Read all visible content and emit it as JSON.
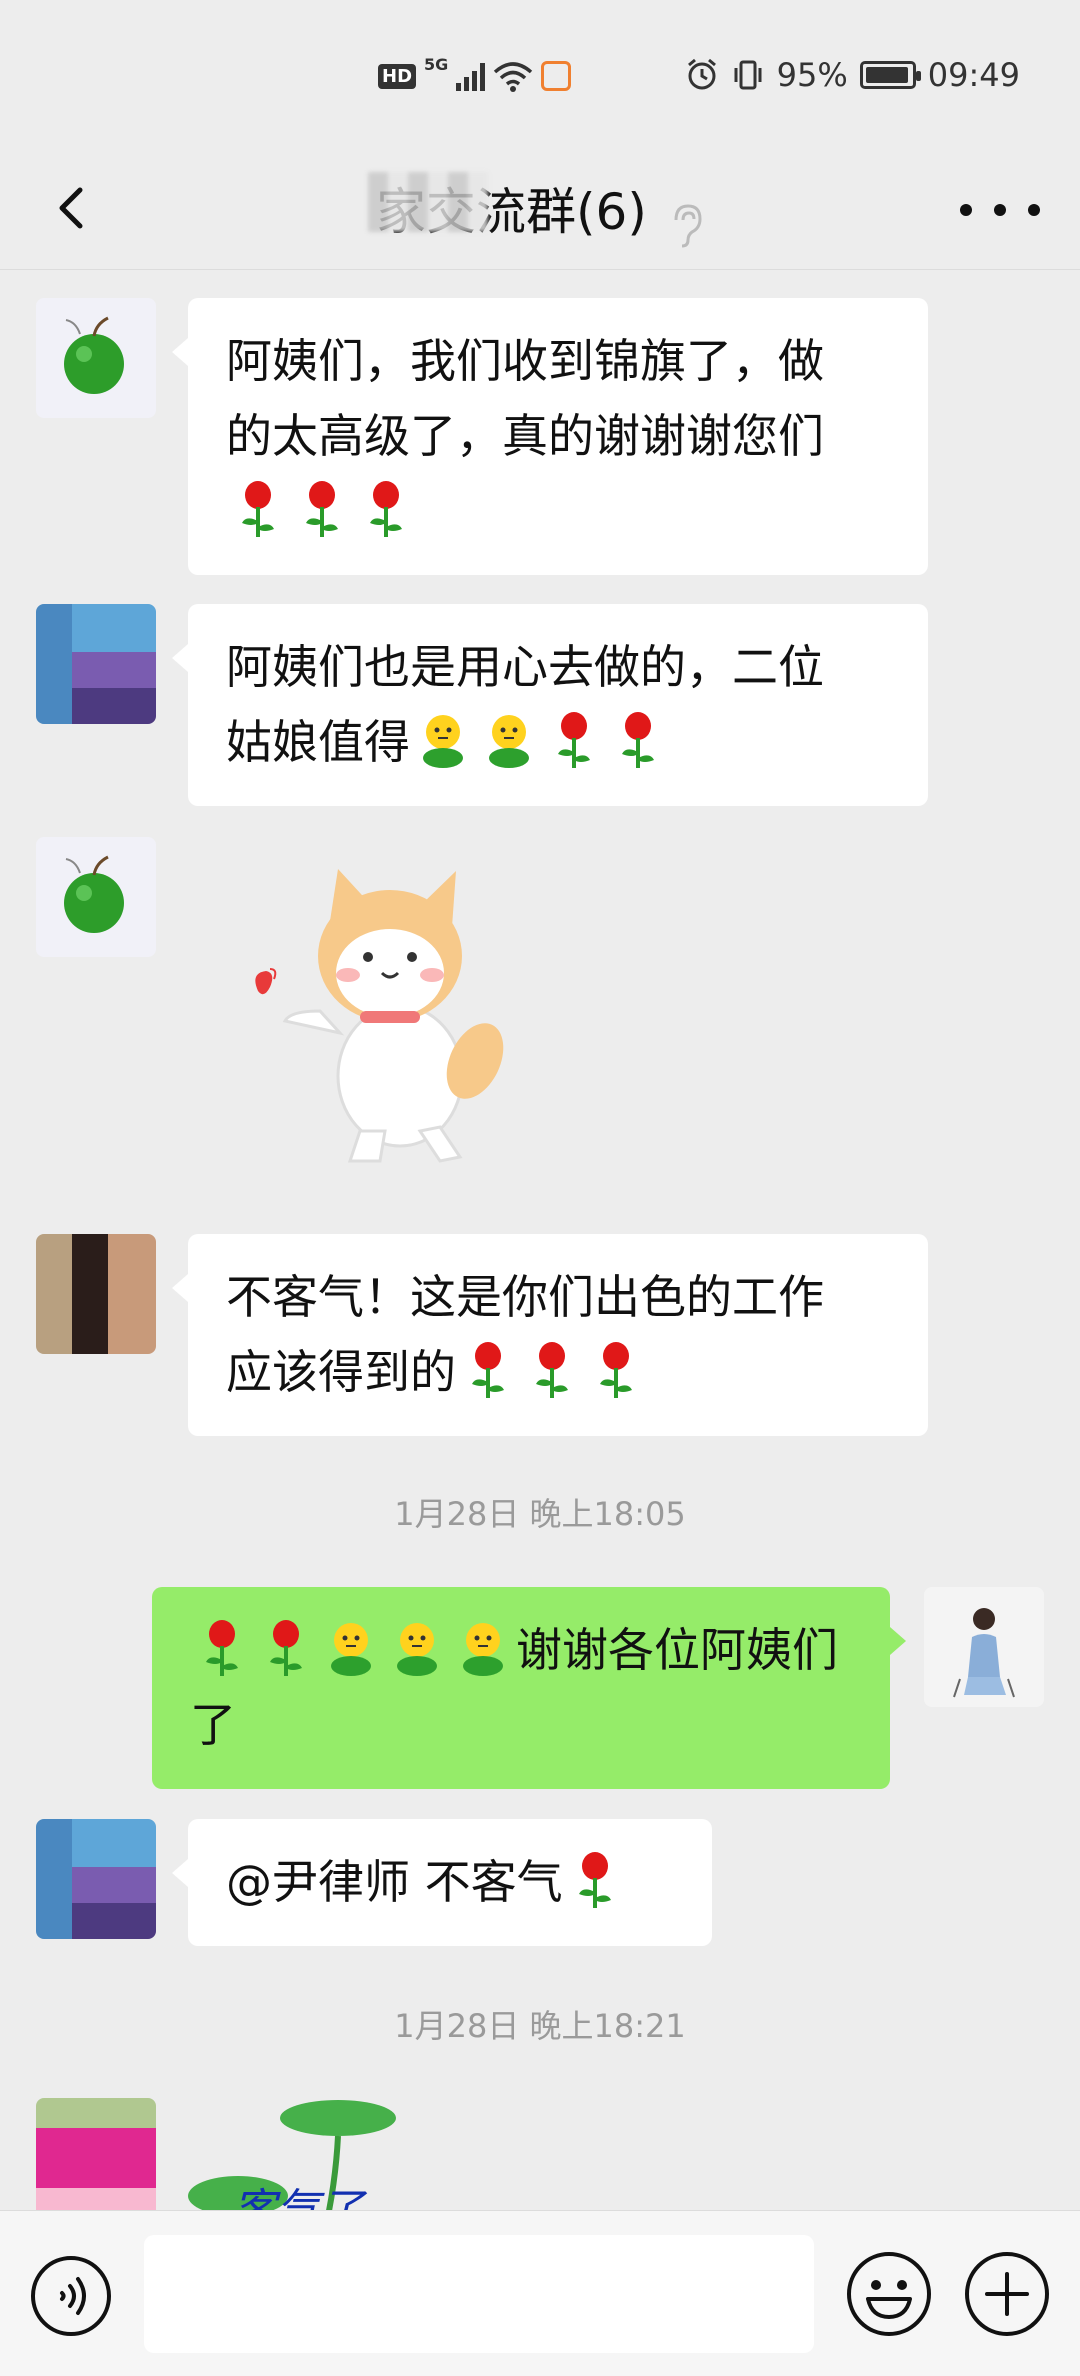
{
  "status_bar": {
    "hd": "HD",
    "network": "5G",
    "battery_percent": "95%",
    "battery_level": 0.95,
    "time": "09:49"
  },
  "header": {
    "title": "家交流群(6)",
    "back_icon": "chevron-left-icon",
    "more_icon": "more-horizontal-icon",
    "mute_icon": "ear-icon"
  },
  "messages": [
    {
      "sender": "apple-avatar",
      "text_lines": [
        "阿姨们，我们收到锦旗了，做",
        "的太高级了，真的谢谢谢您们"
      ],
      "emoji_tail": [
        "rose",
        "rose",
        "rose"
      ]
    },
    {
      "sender": "mosaic-avatar-1",
      "text_lines": [
        "阿姨们也是用心去做的，二位",
        "姑娘值得"
      ],
      "emoji_tail": [
        "face",
        "face",
        "rose",
        "rose"
      ]
    },
    {
      "sender": "apple-avatar",
      "sticker": "shiba-dog-heart-sticker"
    },
    {
      "sender": "mosaic-avatar-2",
      "text_lines": [
        "不客气！这是你们出色的工作",
        "应该得到的"
      ],
      "emoji_tail": [
        "rose",
        "rose",
        "rose"
      ]
    },
    {
      "timestamp": "1月28日 晚上18:05"
    },
    {
      "sender": "me",
      "text_lines": [
        "谢谢各位阿姨们",
        "了"
      ],
      "emoji_head": [
        "rose",
        "rose",
        "face",
        "face",
        "face"
      ]
    },
    {
      "sender": "mosaic-avatar-1",
      "text": "@尹律师  不客气",
      "emoji_tail": [
        "rose"
      ]
    },
    {
      "timestamp": "1月28日 晚上18:21"
    },
    {
      "sender": "mosaic-avatar-3",
      "sticker": "lotus-leaf-sticker",
      "sticker_text": "客气了"
    }
  ],
  "input": {
    "placeholder": "",
    "voice_icon": "voice-icon",
    "emoji_icon": "emoji-icon",
    "plus_icon": "plus-icon"
  },
  "colors": {
    "background": "#ededed",
    "my_bubble": "#95ec69",
    "other_bubble": "#ffffff",
    "timestamp": "#9a9a9a"
  }
}
